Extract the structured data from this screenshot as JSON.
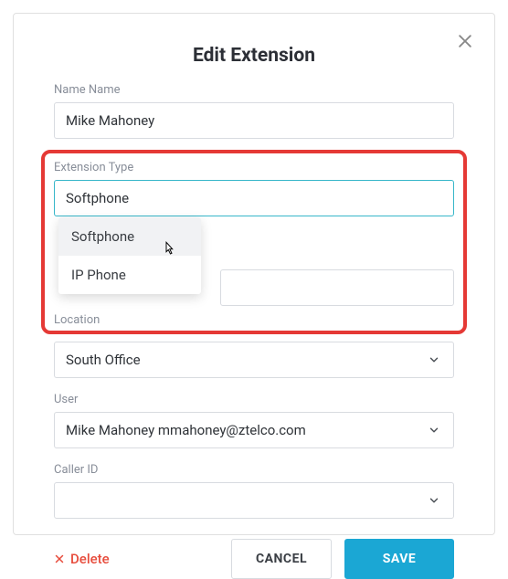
{
  "modal": {
    "title": "Edit Extension"
  },
  "fields": {
    "name": {
      "label": "Name Name",
      "value": "Mike Mahoney"
    },
    "extensionType": {
      "label": "Extension Type",
      "value": "Softphone",
      "options": [
        "Softphone",
        "IP Phone"
      ]
    },
    "location": {
      "label": "Location",
      "value": "South Office"
    },
    "user": {
      "label": "User",
      "value": "Mike Mahoney mmahoney@ztelco.com"
    },
    "callerId": {
      "label": "Caller ID",
      "value": ""
    }
  },
  "actions": {
    "delete": "Delete",
    "cancel": "CANCEL",
    "save": "SAVE"
  }
}
